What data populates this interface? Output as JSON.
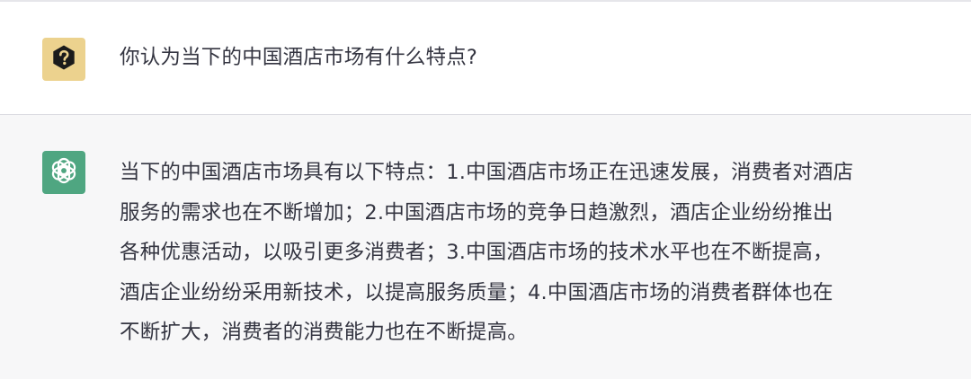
{
  "conversation": {
    "user": {
      "avatar_icon": "question-icon",
      "avatar_color": "#ecd28e",
      "text": "你认为当下的中国酒店市场有什么特点?"
    },
    "assistant": {
      "avatar_icon": "openai-logo-icon",
      "avatar_color": "#4fa681",
      "lines": [
        "当下的中国酒店市场具有以下特点：1.中国酒店市场正在迅速发展，消费者对酒店",
        "服务的需求也在不断增加；2.中国酒店市场的竞争日趋激烈，酒店企业纷纷推出",
        "各种优惠活动，以吸引更多消费者；3.中国酒店市场的技术水平也在不断提高，",
        "酒店企业纷纷采用新技术，以提高服务质量；4.中国酒店市场的消费者群体也在",
        "不断扩大，消费者的消费能力也在不断提高。"
      ]
    }
  }
}
